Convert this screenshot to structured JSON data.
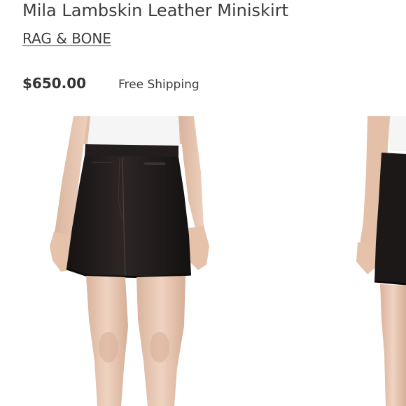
{
  "product": {
    "title": "Mila Lambskin Leather Miniskirt",
    "brand": "RAG & BONE",
    "price": "$650.00",
    "shipping": "Free Shipping"
  },
  "gallery": {
    "images": [
      {
        "name": "front-view",
        "state": "current"
      },
      {
        "name": "side-view",
        "state": "partially-visible"
      }
    ]
  },
  "colors": {
    "text": "#3c3c3c",
    "skirt": "#1e1a19",
    "shirt": "#f4f4f4",
    "skin": "#e8c6b1"
  }
}
